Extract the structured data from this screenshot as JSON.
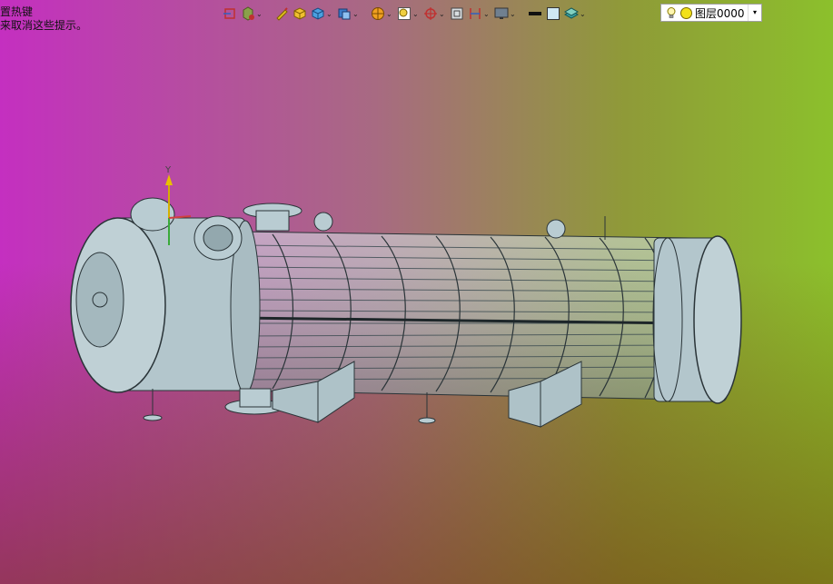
{
  "hint": {
    "line1": "置热键",
    "line2": "来取消这些提示。"
  },
  "toolbar": {
    "items": [
      {
        "name": "view-orient-icon",
        "has_dropdown": false
      },
      {
        "name": "view-display-icon",
        "has_dropdown": true
      },
      {
        "name": "sketch-pen-icon",
        "has_dropdown": false
      },
      {
        "name": "shaded-cube-icon",
        "has_dropdown": false
      },
      {
        "name": "cube-3d-icon",
        "has_dropdown": true
      },
      {
        "name": "section-view-icon",
        "has_dropdown": true
      },
      {
        "name": "render-sphere-icon",
        "has_dropdown": true
      },
      {
        "name": "zoom-fit-icon",
        "has_dropdown": true
      },
      {
        "name": "rotate-view-icon",
        "has_dropdown": true
      },
      {
        "name": "frame-icon",
        "has_dropdown": false
      },
      {
        "name": "dimension-icon",
        "has_dropdown": true
      },
      {
        "name": "monitor-icon",
        "has_dropdown": true
      },
      {
        "name": "line-color-icon",
        "has_dropdown": false
      },
      {
        "name": "fill-color-icon",
        "has_dropdown": false
      },
      {
        "name": "layer-stack-icon",
        "has_dropdown": true
      }
    ],
    "dropdown_glyph": "⌄"
  },
  "layer": {
    "name": "图层0000",
    "arrow": "▾"
  },
  "colors": {
    "model_fill": "#b6c9cf",
    "model_stroke": "#2a3438"
  }
}
